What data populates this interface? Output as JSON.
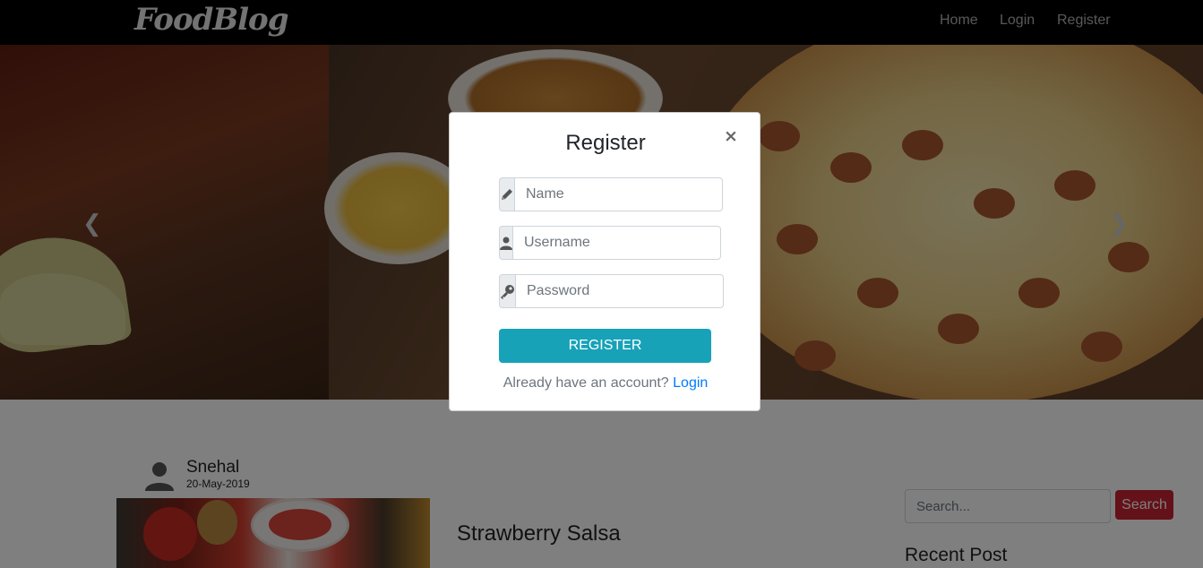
{
  "navbar": {
    "brand": "FoodBlog",
    "links": [
      "Home",
      "Login",
      "Register"
    ]
  },
  "carousel": {
    "prev_icon": "chevron-left-icon",
    "next_icon": "chevron-right-icon"
  },
  "post": {
    "author": "Snehal",
    "date": "20-May-2019",
    "title": "Strawberry Salsa"
  },
  "sidebar": {
    "search_placeholder": "Search...",
    "search_button": "Search",
    "recent_heading": "Recent Post"
  },
  "modal": {
    "title": "Register",
    "close": "×",
    "fields": [
      {
        "icon": "pencil-icon",
        "placeholder": "Name"
      },
      {
        "icon": "user-icon",
        "placeholder": "Username"
      },
      {
        "icon": "key-icon",
        "placeholder": "Password"
      }
    ],
    "submit": "REGISTER",
    "account_prompt": "Already have an account?",
    "login_link": "Login"
  },
  "colors": {
    "navbar_bg": "#000000",
    "primary": "#17a2b8",
    "danger": "#c82333",
    "link": "#007bff"
  }
}
